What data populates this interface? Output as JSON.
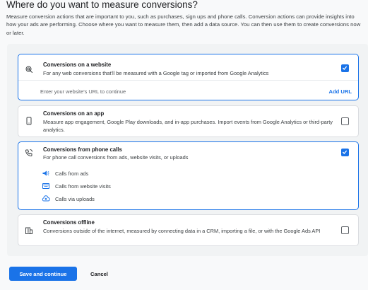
{
  "page": {
    "title": "Where do you want to measure conversions?",
    "description": "Measure conversion actions that are important to you, such as purchases, sign ups and phone calls. Conversion actions can provide insights into how your ads are performing. Choose where you want to measure them, then add a data source. You can then use them to create conversions now or later."
  },
  "options": {
    "website": {
      "title": "Conversions on a website",
      "subtitle": "For any web conversions that'll be measured with a Google tag or imported from Google Analytics",
      "checked": true,
      "icon": "cursor-click-icon",
      "url_placeholder": "Enter your website's URL to continue",
      "add_url_label": "Add URL"
    },
    "app": {
      "title": "Conversions on an app",
      "subtitle": "Measure app engagement, Google Play downloads, and in-app purchases. Import events from Google Analytics or third-party analytics.",
      "checked": false,
      "icon": "smartphone-icon"
    },
    "phone": {
      "title": "Conversions from phone calls",
      "subtitle": "For phone call conversions from ads, website visits, or uploads",
      "checked": true,
      "icon": "phone-call-icon",
      "sub_options": [
        {
          "label": "Calls from ads",
          "icon": "megaphone-icon"
        },
        {
          "label": "Calls from website visits",
          "icon": "browser-window-icon"
        },
        {
          "label": "Calls via uploads",
          "icon": "cloud-upload-icon"
        }
      ]
    },
    "offline": {
      "title": "Conversions offline",
      "subtitle": "Conversions outside of the internet, measured by connecting data in a CRM, importing a file, or with the Google Ads API",
      "checked": false,
      "icon": "building-icon"
    }
  },
  "actions": {
    "primary_label": "Save and continue",
    "secondary_label": "Cancel"
  },
  "colors": {
    "accent": "#1a73e8",
    "border": "#dadce0",
    "panel_bg": "#f1f3f4"
  }
}
